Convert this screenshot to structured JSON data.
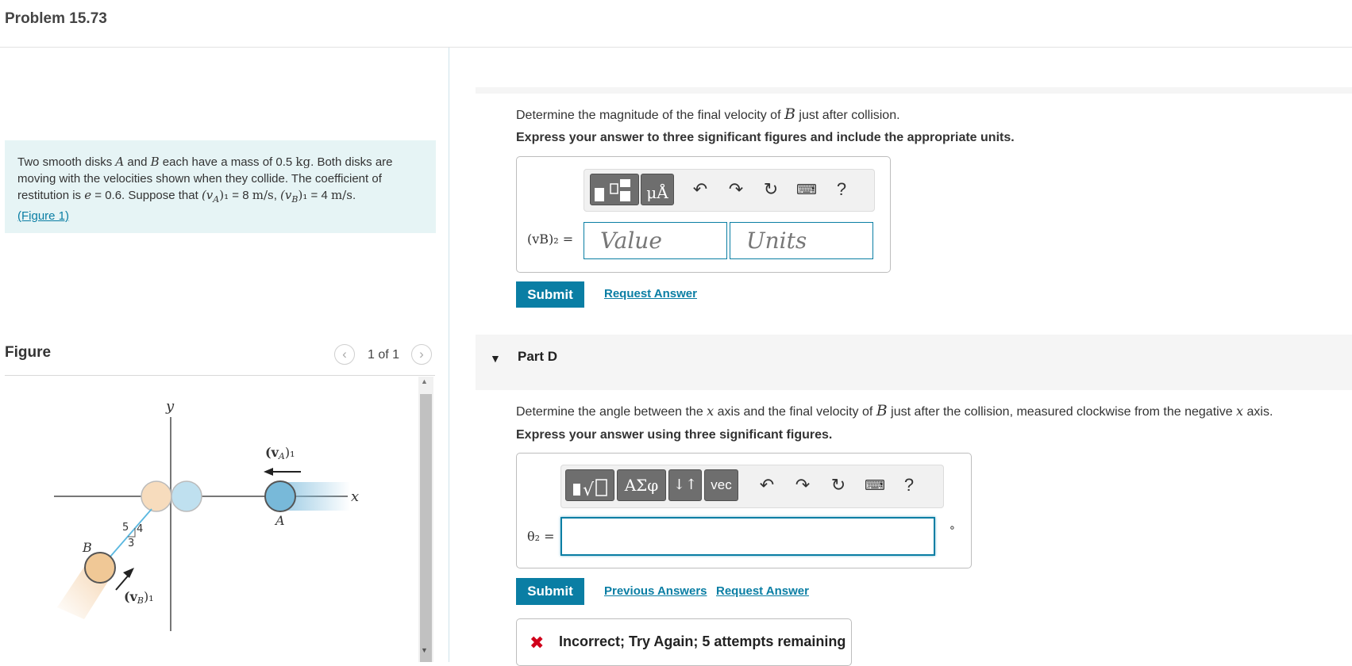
{
  "header": {
    "title": "Problem 15.73"
  },
  "problem": {
    "text_1": "Two smooth disks ",
    "disk_a": "A",
    "text_2": " and ",
    "disk_b": "B",
    "text_3": " each have a mass of 0.5 ",
    "mass_unit": "kg",
    "text_4": ". Both disks are moving with the velocities shown when they collide. The coefficient of restitution is ",
    "e_symbol": "e",
    "text_5": " = 0.6. Suppose that ",
    "va1": "(v",
    "va1_sub": "A",
    "va1_close": ")₁",
    "text_6": " = 8 ",
    "speed_unit_1": "m/s",
    "text_7": ", ",
    "vb1": "(v",
    "vb1_sub": "B",
    "vb1_close": ")₁",
    "text_8": " = 4 ",
    "speed_unit_2": "m/s",
    "text_9": ".",
    "figure_link": "(Figure 1)"
  },
  "figure": {
    "label": "Figure",
    "pager": "1 of 1",
    "prev_icon": "chevron-left-icon",
    "next_icon": "chevron-right-icon",
    "diagram": {
      "y_axis": "y",
      "x_axis": "x",
      "disk_a_label": "A",
      "disk_b_label": "B",
      "va_label": "(v",
      "va_sub": "A",
      "va_tail": ")₁",
      "vb_label": "(v",
      "vb_sub": "B",
      "vb_tail": ")₁",
      "slope_5": "5",
      "slope_4": "4",
      "slope_3": "3"
    }
  },
  "part_c": {
    "question_pre": "Determine the magnitude of the final velocity of ",
    "question_var": "B",
    "question_post": " just after collision.",
    "instruction": "Express your answer to three significant figures and include the appropriate units.",
    "toolbar": {
      "templates_icon": "templates-icon",
      "units_label": "μÅ",
      "undo_icon": "undo-icon",
      "redo_icon": "redo-icon",
      "reset_icon": "reset-icon",
      "keyboard_icon": "keyboard-icon",
      "help_label": "?"
    },
    "input_label": "(vB)₂ =",
    "value_placeholder": "Value",
    "units_placeholder": "Units",
    "submit": "Submit",
    "request_answer": "Request Answer"
  },
  "part_d": {
    "title": "Part D",
    "question_pre": "Determine the angle between the ",
    "question_x1": "x",
    "question_mid": " axis and the final velocity of ",
    "question_b": "B",
    "question_mid2": " just after the collision, measured clockwise from the negative ",
    "question_x2": "x",
    "question_post": " axis.",
    "instruction": "Express your answer using three significant figures.",
    "toolbar": {
      "templates_icon": "templates-icon",
      "greek_label": "ΑΣφ",
      "arrows_label": "↓↑",
      "vec_label": "vec",
      "undo_icon": "undo-icon",
      "redo_icon": "redo-icon",
      "reset_icon": "reset-icon",
      "keyboard_icon": "keyboard-icon",
      "help_label": "?"
    },
    "input_label": "θ₂ =",
    "input_value": "",
    "unit_suffix": "∘",
    "submit": "Submit",
    "previous_answers": "Previous Answers",
    "request_answer": "Request Answer",
    "feedback": "Incorrect; Try Again; 5 attempts remaining"
  }
}
